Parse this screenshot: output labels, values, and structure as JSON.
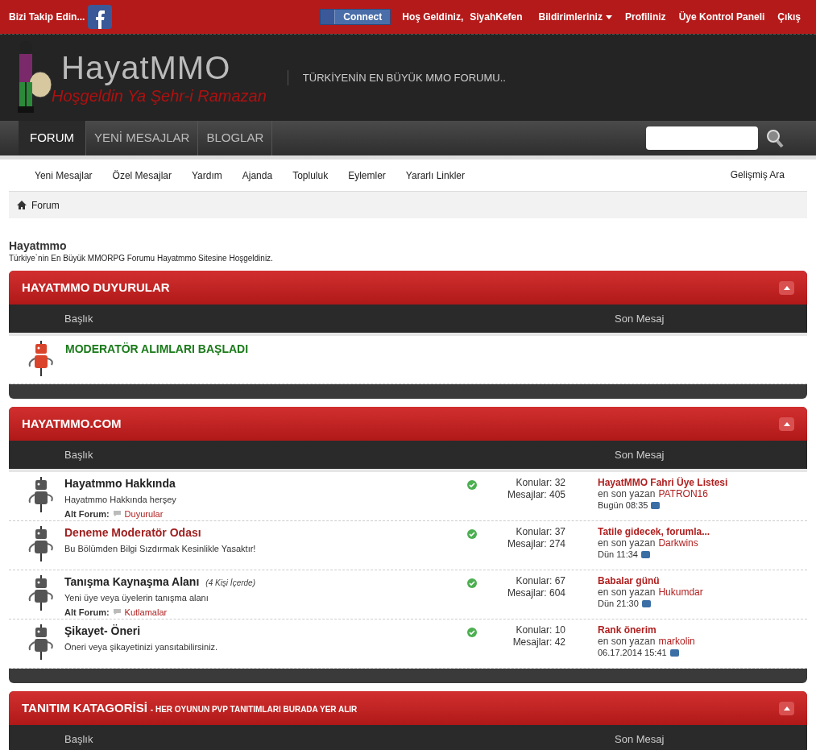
{
  "top_bar": {
    "follow_text": "Bizi Takip Edin...",
    "connect_button": "Connect",
    "welcome": "Hoş Geldiniz,",
    "username": "SiyahKefen",
    "links": [
      {
        "label": "Bildirimleriniz",
        "dropdown": true
      },
      {
        "label": "Profiliniz",
        "dropdown": false
      },
      {
        "label": "Üye Kontrol Paneli",
        "dropdown": false
      },
      {
        "label": "Çıkış",
        "dropdown": false
      }
    ]
  },
  "header": {
    "logo_text": "HayatMMO",
    "logo_subtitle": "Hoşgeldin Ya Şehr-i Ramazan",
    "tagline": "TÜRKİYENİN EN BÜYÜK MMO FORUMU.."
  },
  "nav_tabs": [
    {
      "label": "FORUM",
      "selected": true
    },
    {
      "label": "YENİ MESAJLAR",
      "selected": false
    },
    {
      "label": "BLOGLAR",
      "selected": false
    }
  ],
  "sub_nav": {
    "items": [
      "Yeni Mesajlar",
      "Özel Mesajlar",
      "Yardım",
      "Ajanda",
      "Topluluk",
      "Eylemler",
      "Yararlı Linkler"
    ],
    "advanced_search": "Gelişmiş Ara"
  },
  "breadcrumb": "Forum",
  "intro": {
    "title": "Hayatmmo",
    "description": "Türkiye`nin En Büyük MMORPG Forumu Hayatmmo Sitesine Hoşgeldiniz."
  },
  "categories": [
    {
      "title": "HAYATMMO DUYURULAR",
      "columns": [
        "Başlık",
        "Son Mesaj"
      ],
      "forums": [
        {
          "kind": "announcement",
          "title": "MODERATÖR ALIMLARI BAŞLADI",
          "color": "#1a7a1a"
        }
      ]
    },
    {
      "title": "HAYATMMO.COM",
      "columns": [
        "Başlık",
        "Son Mesaj"
      ],
      "forums": [
        {
          "kind": "forum",
          "title": "Hayatmmo Hakkında",
          "color": "#222222",
          "description": "Hayatmmo Hakkında herşey",
          "subforum_label": "Alt Forum:",
          "subforum": "Duyurular",
          "threads": "Konular: 32",
          "posts": "Mesajlar: 405",
          "last_post": {
            "title": "HayatMMO Fahri Üye Listesi",
            "by": "en son yazan",
            "user": "PATRON16",
            "time": "Bugün 08:35"
          }
        },
        {
          "kind": "forum",
          "title": "Deneme Moderatör Odası",
          "color": "#a02020",
          "description": "Bu Bölümden Bilgi Sızdırmak Kesinlikle Yasaktır!",
          "threads": "Konular: 37",
          "posts": "Mesajlar: 274",
          "last_post": {
            "title": "Tatile gidecek, forumla...",
            "by": "en son yazan",
            "user": "Darkwins",
            "time": "Dün 11:34"
          }
        },
        {
          "kind": "forum",
          "title": "Tanışma Kaynaşma Alanı",
          "color": "#222222",
          "viewers": "(4 Kişi İçerde)",
          "description": "Yeni üye veya üyelerin tanışma alanı",
          "subforum_label": "Alt Forum:",
          "subforum": "Kutlamalar",
          "threads": "Konular: 67",
          "posts": "Mesajlar: 604",
          "last_post": {
            "title": "Babalar günü",
            "by": "en son yazan",
            "user": "Hukumdar",
            "time": "Dün 21:30"
          }
        },
        {
          "kind": "forum",
          "title": "Şikayet- Öneri",
          "color": "#222222",
          "description": "Öneri veya şikayetinizi yansıtabilirsiniz.",
          "threads": "Konular: 10",
          "posts": "Mesajlar: 42",
          "last_post": {
            "title": "Rank önerim",
            "by": "en son yazan",
            "user": "markolin",
            "time": "06.17.2014 15:41"
          }
        }
      ]
    },
    {
      "title": "TANITIM KATAGORİSİ",
      "subtitle": "- HER OYUNUN PVP TANITIMLARI BURADA YER ALIR",
      "columns": [
        "Başlık",
        "Son Mesaj"
      ]
    }
  ]
}
